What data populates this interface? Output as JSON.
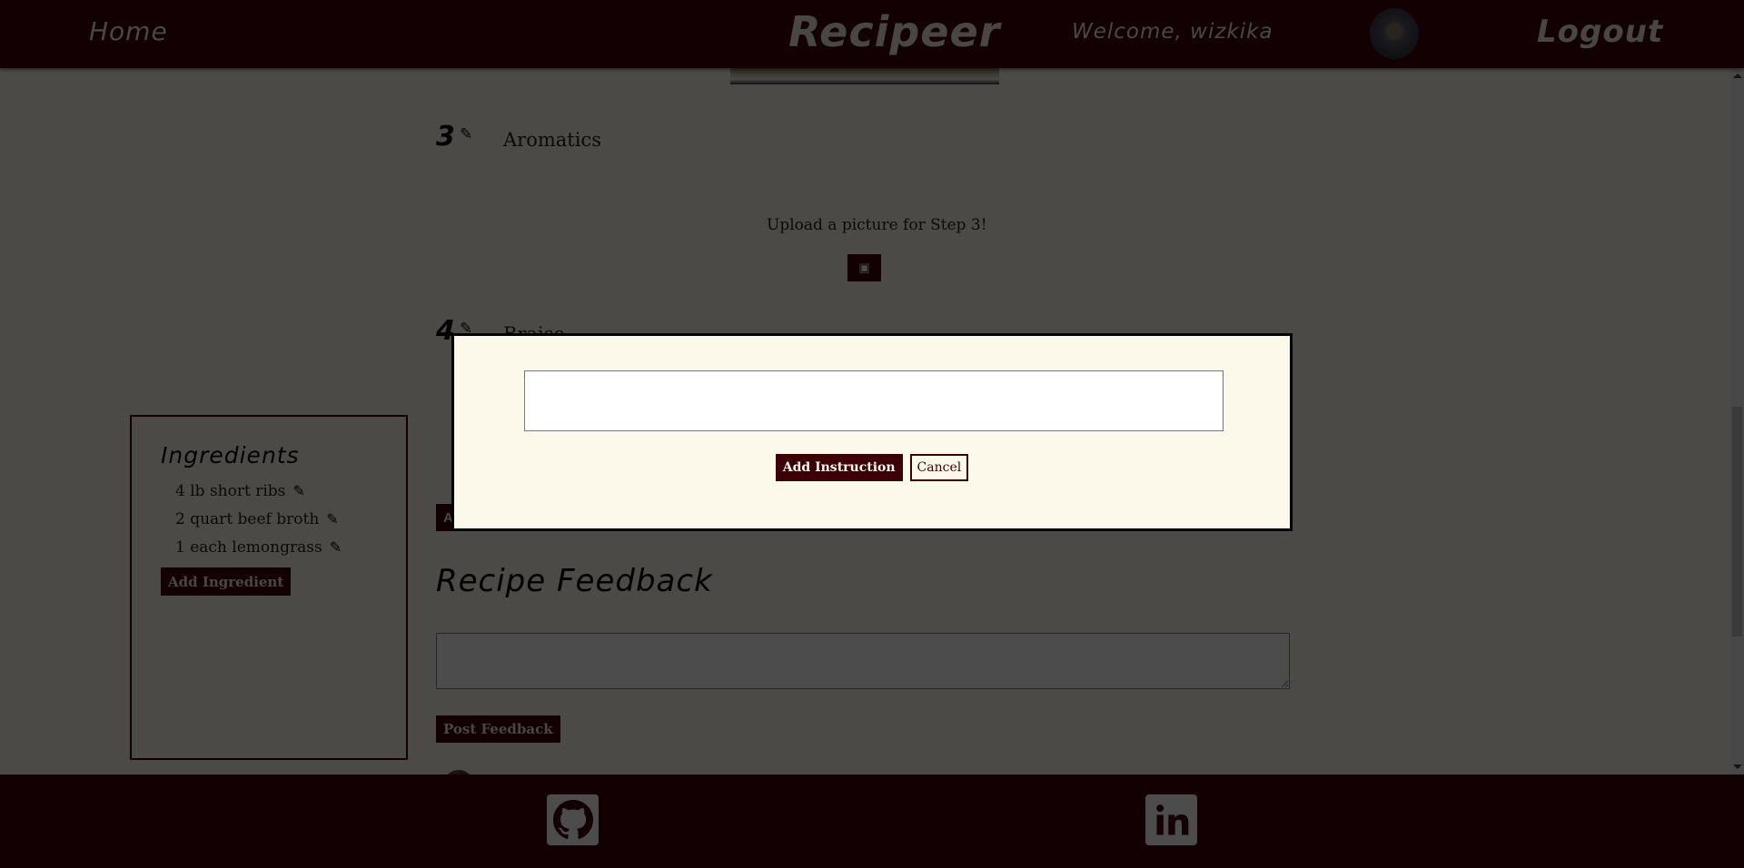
{
  "header": {
    "home_label": "Home",
    "brand": "Recipeer",
    "welcome_text": "Welcome, wizkika",
    "avatar_icon": "user-avatar-cat",
    "logout_label": "Logout"
  },
  "steps": [
    {
      "number": "3",
      "text": "Aromatics",
      "edit_icon": "pencil-icon",
      "upload_prompt": "Upload a picture for Step 3!",
      "upload_icon": "camera-icon"
    },
    {
      "number": "4",
      "text": "Braise",
      "edit_icon": "pencil-icon"
    }
  ],
  "add_step_button_label": "A",
  "ingredients": {
    "title": "Ingredients",
    "items": [
      {
        "text": "4 lb short ribs",
        "edit_icon": "pencil-icon"
      },
      {
        "text": "2 quart beef broth",
        "edit_icon": "pencil-icon"
      },
      {
        "text": "1 each lemongrass",
        "edit_icon": "pencil-icon"
      }
    ],
    "add_label": "Add Ingredient"
  },
  "feedback": {
    "title": "Recipe Feedback",
    "input_value": "",
    "post_label": "Post Feedback"
  },
  "modal": {
    "input_value": "",
    "add_label": "Add Instruction",
    "cancel_label": "Cancel"
  },
  "footer": {
    "links": [
      {
        "icon": "github-icon"
      },
      {
        "icon": "linkedin-icon"
      }
    ]
  },
  "colors": {
    "brand": "#3d0008",
    "background": "#fdf9ea",
    "overlay": "rgba(0,0,0,0.70)"
  },
  "icons": {
    "pencil": "✎",
    "camera": "📷"
  }
}
